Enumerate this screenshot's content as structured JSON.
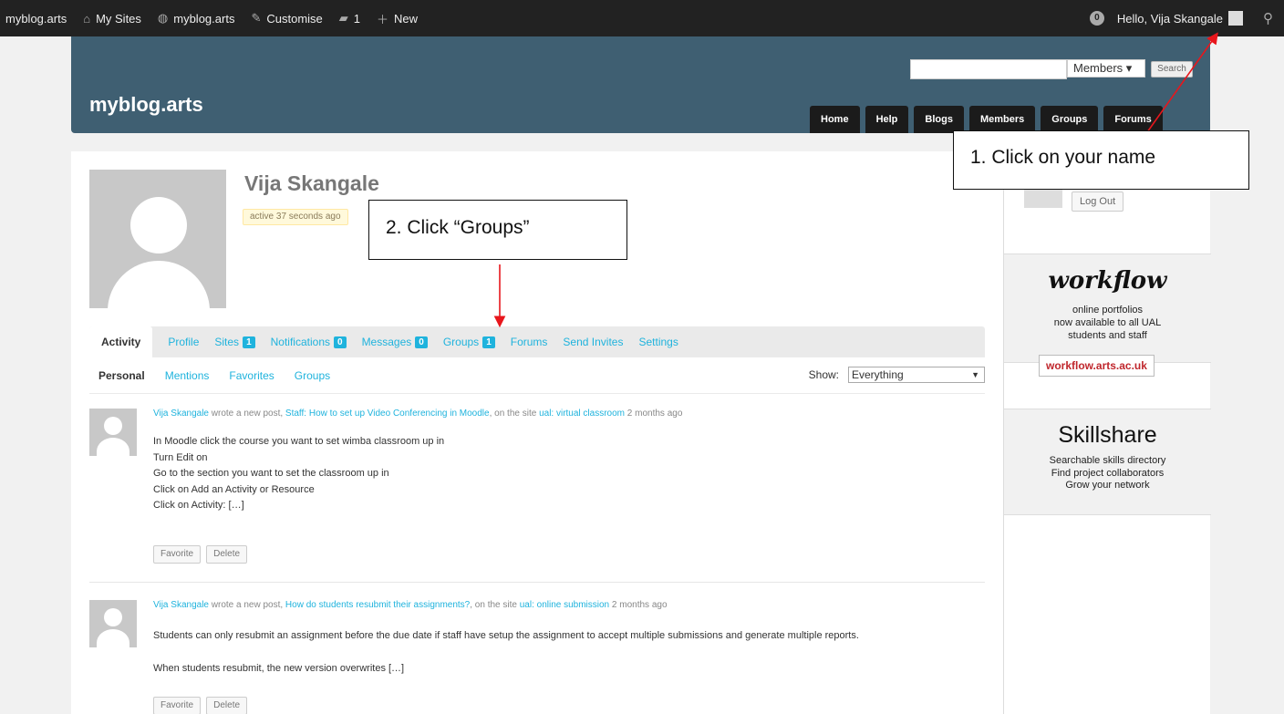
{
  "admin_bar": {
    "items": [
      {
        "label": "myblog.arts",
        "icon": ""
      },
      {
        "label": "My Sites",
        "icon": "my-sites-icon"
      },
      {
        "label": "myblog.arts",
        "icon": "dashboard-icon"
      },
      {
        "label": "Customise",
        "icon": "brush-icon"
      },
      {
        "label": "1",
        "icon": "comment-icon"
      },
      {
        "label": "New",
        "icon": "plus-icon"
      }
    ],
    "notification_count": "0",
    "greeting": "Hello, Vija Skangale"
  },
  "header": {
    "site_title": "myblog.arts",
    "search_select": "Members ▾",
    "search_button": "Search",
    "nav": [
      "Home",
      "Help",
      "Blogs",
      "Members",
      "Groups",
      "Forums"
    ]
  },
  "profile": {
    "name": "Vija Skangale",
    "activity": "active 37 seconds ago",
    "tabs": [
      {
        "label": "Activity",
        "count": ""
      },
      {
        "label": "Profile",
        "count": ""
      },
      {
        "label": "Sites",
        "count": "1"
      },
      {
        "label": "Notifications",
        "count": "0"
      },
      {
        "label": "Messages",
        "count": "0"
      },
      {
        "label": "Groups",
        "count": "1"
      },
      {
        "label": "Forums",
        "count": ""
      },
      {
        "label": "Send Invites",
        "count": ""
      },
      {
        "label": "Settings",
        "count": ""
      }
    ],
    "subtabs": [
      "Personal",
      "Mentions",
      "Favorites",
      "Groups"
    ],
    "show_label": "Show:",
    "show_value": "Everything"
  },
  "entries": [
    {
      "author": "Vija Skangale",
      "action": " wrote a new post, ",
      "post": "Staff: How to set up Video Conferencing in Moodle",
      "mid": ", on the site ",
      "site": "ual: virtual classroom",
      "time": " 2 months ago",
      "lines": [
        "In Moodle click the course you want to set wimba classroom up in",
        "Turn Edit on",
        "Go to the section you want to set the classroom up in",
        "Click on Add an Activity or Resource",
        "Click on Activity: […]"
      ],
      "favorite": "Favorite",
      "delete": "Delete"
    },
    {
      "author": "Vija Skangale",
      "action": " wrote a new post, ",
      "post": "How do students resubmit their assignments?",
      "mid": ", on the site ",
      "site": "ual: online submission",
      "time": " 2 months ago",
      "lines": [
        "Students can only resubmit an assignment before the due date if staff have setup the assignment to accept multiple submissions and generate multiple reports.",
        "When students resubmit, the new version overwrites […]"
      ],
      "favorite": "Favorite",
      "delete": "Delete"
    }
  ],
  "sidebar": {
    "logout": "Log Out",
    "workflow_logo": "workflow",
    "workflow_lines": [
      "online portfolios",
      "now available to all UAL",
      "students and staff"
    ],
    "workflow_link": "workflow.arts.ac.uk",
    "skillshare_title": "Skillshare",
    "skillshare_lines": [
      "Searchable skills directory",
      "Find project collaborators",
      "Grow your network"
    ]
  },
  "annotations": {
    "callout1": "1. Click on your name",
    "callout2": "2. Click “Groups”",
    "arrow_color": "#e8161c"
  }
}
